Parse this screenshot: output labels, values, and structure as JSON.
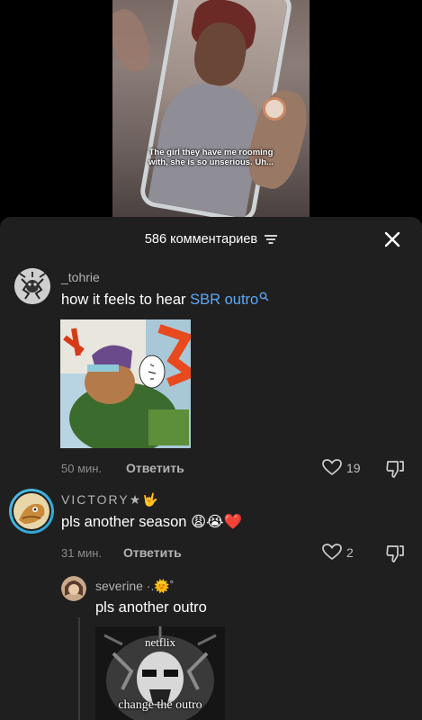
{
  "video": {
    "caption_line1": "The girl they have me rooming",
    "caption_line2": "with, she is so unserious. Uh..."
  },
  "comments_sheet": {
    "title": "586 комментариев"
  },
  "comments": [
    {
      "username": "_tohrie",
      "text_prefix": "how it feels to hear ",
      "link_text": "SBR outro",
      "time": "50 мин.",
      "reply_label": "Ответить",
      "likes": "19"
    },
    {
      "username": "VICTORY★🤟",
      "text": "pls another season 😩😭❤️",
      "time": "31 мин.",
      "reply_label": "Ответить",
      "likes": "2"
    }
  ],
  "reply_comment": {
    "username": "severine ·.🌞˚",
    "text": "pls another outro",
    "image_text_top": "netflix",
    "image_text_bottom": "change the outro"
  },
  "colors": {
    "sheet_bg": "#1f1f1f",
    "link": "#5ea8f5",
    "muted": "#8a8a8a"
  }
}
